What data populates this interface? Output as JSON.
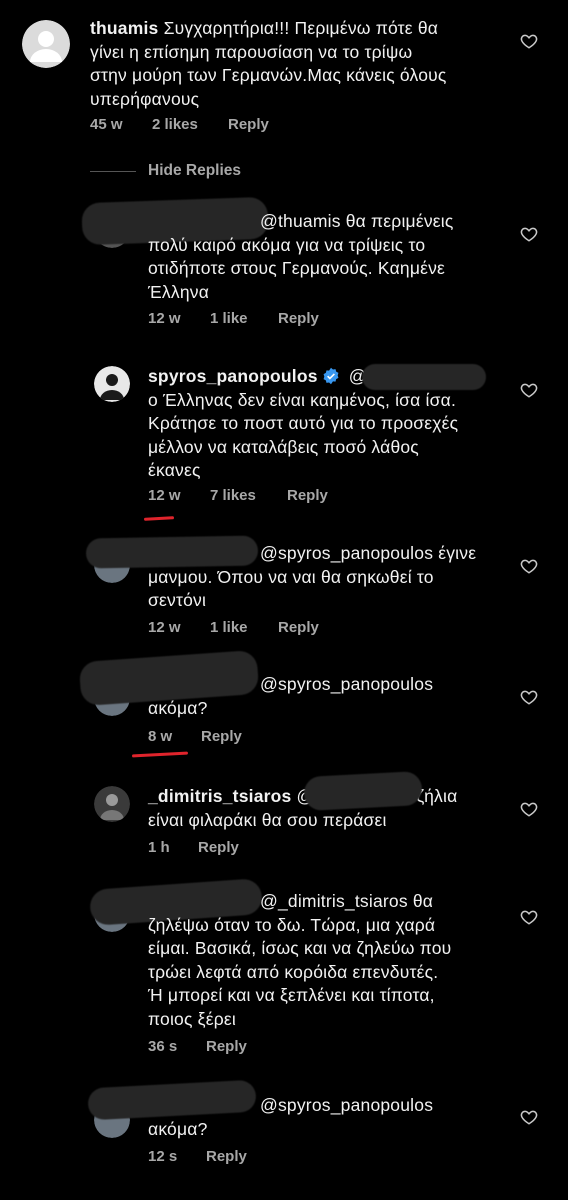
{
  "comments": [
    {
      "username": "thuamis",
      "text": "Συγχαρητήρια!!! Περιμένω πότε θα γίνει η επίσημη παρουσίαση να το τρίψω στην μούρη των Γερμανών.Μας κάνεις όλους υπερήφανους",
      "lines": [
        "Συγχαρητήρια!!! Περιμένω πότε θα",
        "γίνει η επίσημη παρουσίαση να το τρίψω",
        "στην μούρη των Γερμανών.Μας κάνεις όλους",
        "υπερήφανους"
      ],
      "time": "45 w",
      "likes": "2 likes",
      "reply": "Reply"
    },
    {
      "username": "",
      "mention": "@thuamis",
      "lines": [
        "θα περιμένεις",
        "πολύ καιρό ακόμα για να τρίψεις το",
        "οτιδήποτε στους Γερμανούς. Καημένε",
        "Έλληνα"
      ],
      "time": "12 w",
      "likes": "1 like",
      "reply": "Reply"
    },
    {
      "username": "spyros_panopoulos",
      "mention": "@",
      "lines": [
        "ο Έλληνας δεν είναι καημένος, ίσα ίσα.",
        "Κράτησε το ποστ αυτό για το προσεχές",
        "μέλλον να καταλάβεις ποσό λάθος",
        "έκανες"
      ],
      "time": "12 w",
      "likes": "7 likes",
      "reply": "Reply"
    },
    {
      "username": "",
      "mention": "@spyros_panopoulos",
      "lines": [
        "έγινε",
        "μανμου. Όπου να ναι θα σηκωθεί το",
        "σεντόνι"
      ],
      "time": "12 w",
      "likes": "1 like",
      "reply": "Reply"
    },
    {
      "username": "",
      "mention": "@spyros_panopoulos",
      "lines": [
        "ακόμα?"
      ],
      "time": "8 w",
      "reply": "Reply"
    },
    {
      "username": "_dimitris_tsiaros",
      "mention": "@",
      "lines": [
        "ζήλια",
        "είναι φιλαράκι θα σου περάσει"
      ],
      "time": "1 h",
      "reply": "Reply"
    },
    {
      "username": "",
      "mention": "@_dimitris_tsiaros",
      "lines": [
        "θα",
        "ζηλέψω όταν το δω. Τώρα, μια χαρά",
        "είμαι. Βασικά, ίσως και να ζηλεύω που",
        "τρώει λεφτά από κορόιδα επενδυτές.",
        "Ή μπορεί και να ξεπλένει και τίποτα,",
        "ποιος ξέρει"
      ],
      "time": "36 s",
      "reply": "Reply"
    },
    {
      "username": "",
      "mention": "@spyros_panopoulos",
      "lines": [
        "ακόμα?"
      ],
      "time": "12 s",
      "reply": "Reply"
    }
  ],
  "hide_replies": "Hide Replies",
  "icons": {
    "like": "heart-outline-icon",
    "verified": "verified-badge-icon"
  },
  "colors": {
    "background": "#000000",
    "meta": "#a8a8a8",
    "verified": "#3897f0",
    "annotation": "#e0242c"
  }
}
